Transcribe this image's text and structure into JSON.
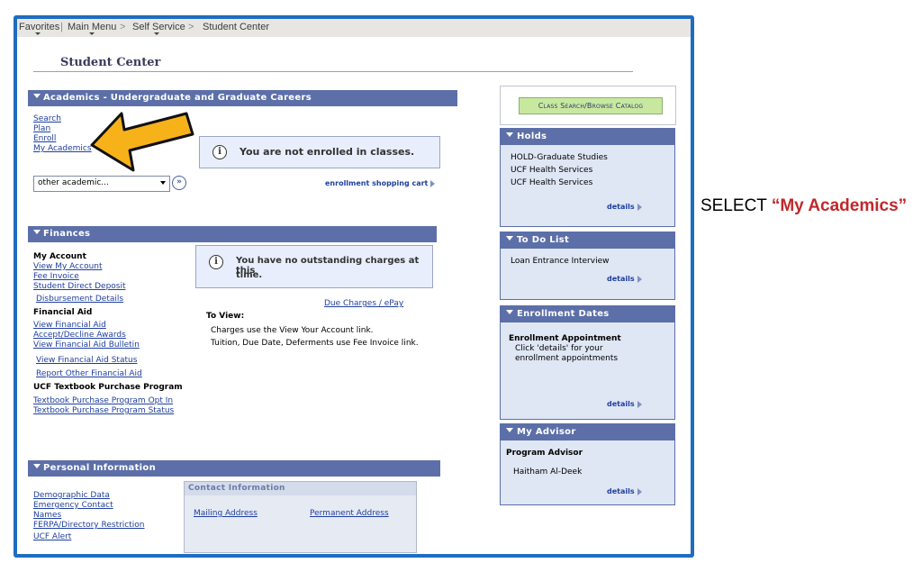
{
  "breadcrumb": {
    "favorites": "Favorites",
    "main_menu": "Main Menu",
    "self_service": "Self Service",
    "current": "Student Center",
    "sep": ">"
  },
  "page_title": "Student Center",
  "academics": {
    "header": "Academics - Undergraduate and Graduate Careers",
    "links": [
      "Search",
      "Plan",
      "Enroll",
      "My Academics"
    ],
    "not_enrolled_msg": "You are not enrolled in classes.",
    "dropdown_value": "other academic...",
    "cart_link": "enrollment shopping cart"
  },
  "finances": {
    "header": "Finances",
    "my_account_label": "My Account",
    "account_links": [
      "View My Account",
      "Fee Invoice",
      "Student Direct Deposit",
      "Disbursement Details"
    ],
    "financial_aid_label": "Financial Aid",
    "aid_links": [
      "View Financial Aid",
      "Accept/Decline Awards",
      "View Financial Aid Bulletin",
      "View Financial Aid Status",
      "Report Other Financial Aid"
    ],
    "textbook_label": "UCF Textbook Purchase Program",
    "textbook_links": [
      "Textbook Purchase Program Opt In",
      "Textbook Purchase Program Status"
    ],
    "no_charges_msg_1": "You have no outstanding charges at this",
    "no_charges_msg_2": "time.",
    "due_charges_link": "Due Charges / ePay",
    "to_view_label": "To View:",
    "to_view_line1": "Charges use the View Your Account link.",
    "to_view_line2": "Tuition, Due Date, Deferments use Fee Invoice link."
  },
  "personal": {
    "header": "Personal Information",
    "links": [
      "Demographic Data",
      "Emergency Contact",
      "Names",
      "FERPA/Directory Restriction",
      "UCF Alert"
    ],
    "contact_header": "Contact Information",
    "mailing_address": "Mailing Address",
    "permanent_address": "Permanent Address"
  },
  "right": {
    "class_search_button": "Class Search/Browse Catalog",
    "holds_header": "Holds",
    "holds_items": [
      "HOLD-Graduate Studies",
      "UCF Health Services",
      "UCF Health Services"
    ],
    "todo_header": "To Do List",
    "todo_items": [
      "Loan Entrance Interview"
    ],
    "enrollment_header": "Enrollment Dates",
    "enrollment_title": "Enrollment Appointment",
    "enrollment_line1": "Click 'details' for your",
    "enrollment_line2": "enrollment appointments",
    "advisor_header": "My Advisor",
    "advisor_label": "Program Advisor",
    "advisor_name": "Haitham Al-Deek",
    "details_label": "details"
  },
  "callout": {
    "prefix": "SELECT ",
    "highlight": "“My Academics”"
  },
  "colors": {
    "frame_border": "#1f6cc0",
    "band_blue": "#5c6fa8",
    "arrow_fill": "#f7b21a",
    "callout_red": "#c0282b",
    "link_blue": "#1f3f9f"
  }
}
